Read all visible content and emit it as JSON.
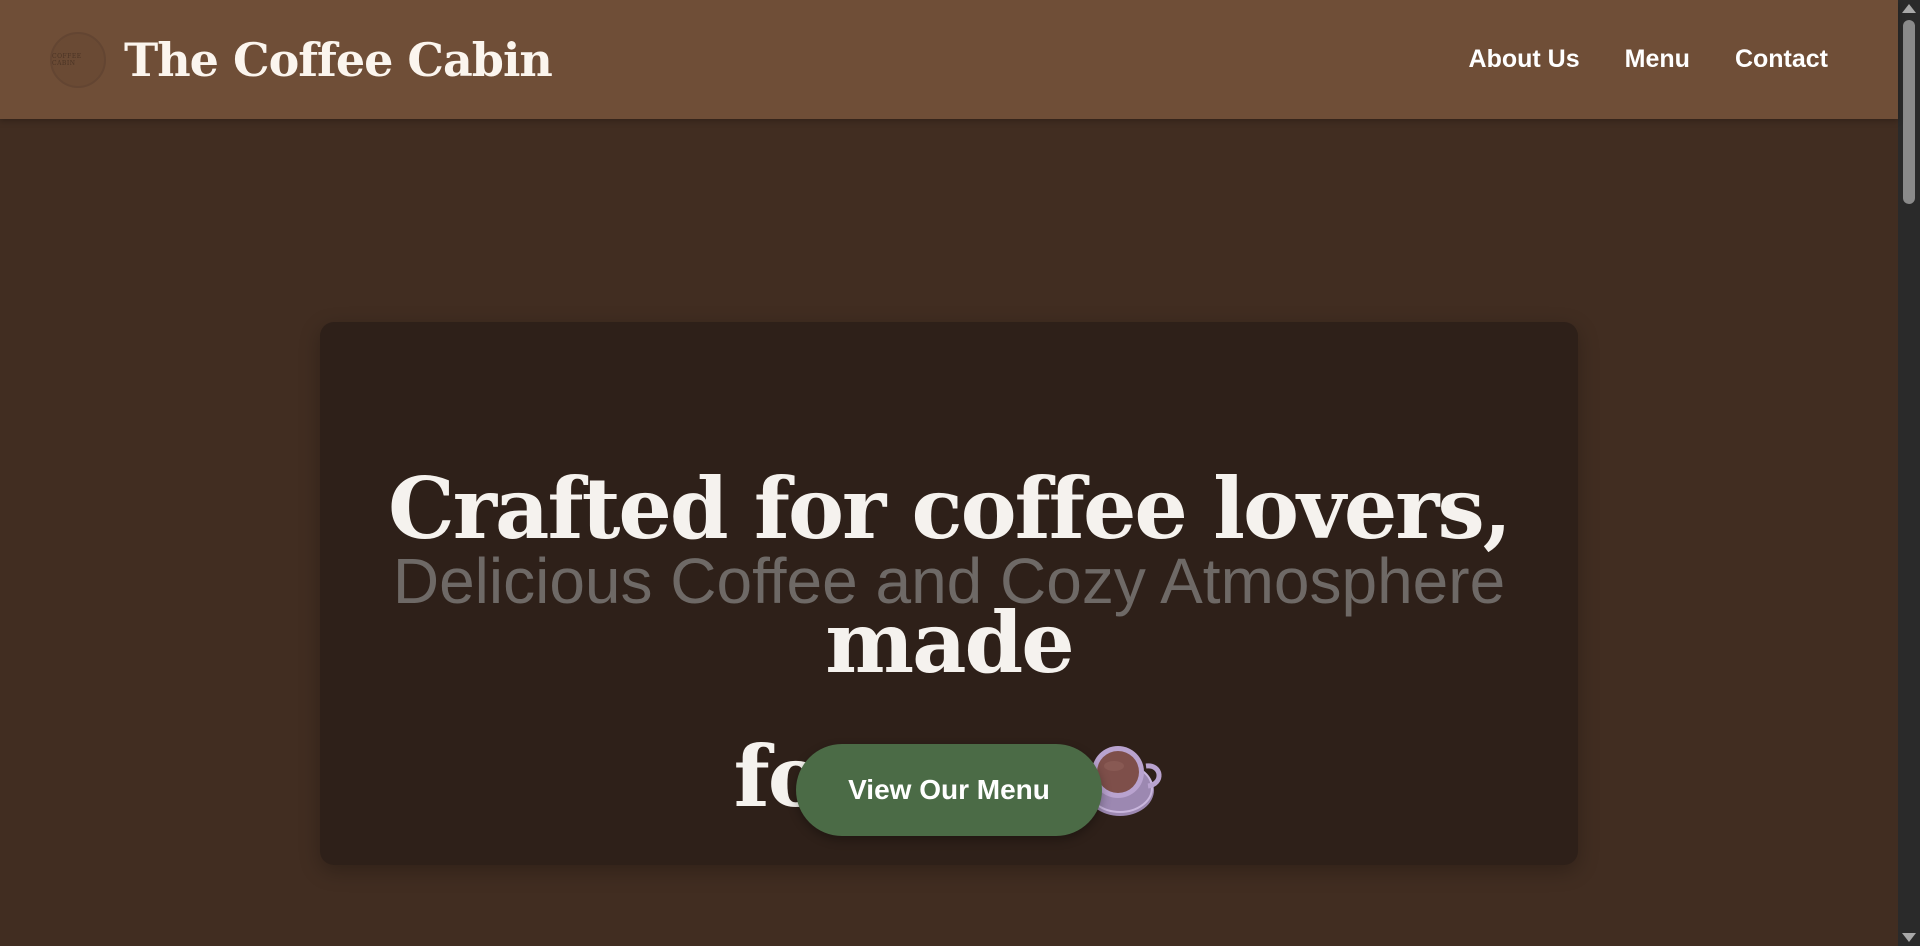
{
  "header": {
    "brand_name": "The Coffee Cabin",
    "logo_text": "COFFEE CABIN",
    "nav": [
      {
        "label": "About Us"
      },
      {
        "label": "Menu"
      },
      {
        "label": "Contact"
      }
    ]
  },
  "hero": {
    "title": "Crafted for coffee lovers, made for you",
    "title_line1": "Crafted for coffee lovers, made",
    "title_line2": "for you",
    "subtitle": "Delicious Coffee and Cozy Atmosphere",
    "cta_label": "View Our Menu",
    "icon": "coffee-cup-icon"
  },
  "colors": {
    "header_bg": "#6f4e37",
    "page_bg": "#412d21",
    "card_bg": "#2e2019",
    "cta_bg": "#4b6b46",
    "cup_color": "#b9a3cf"
  }
}
